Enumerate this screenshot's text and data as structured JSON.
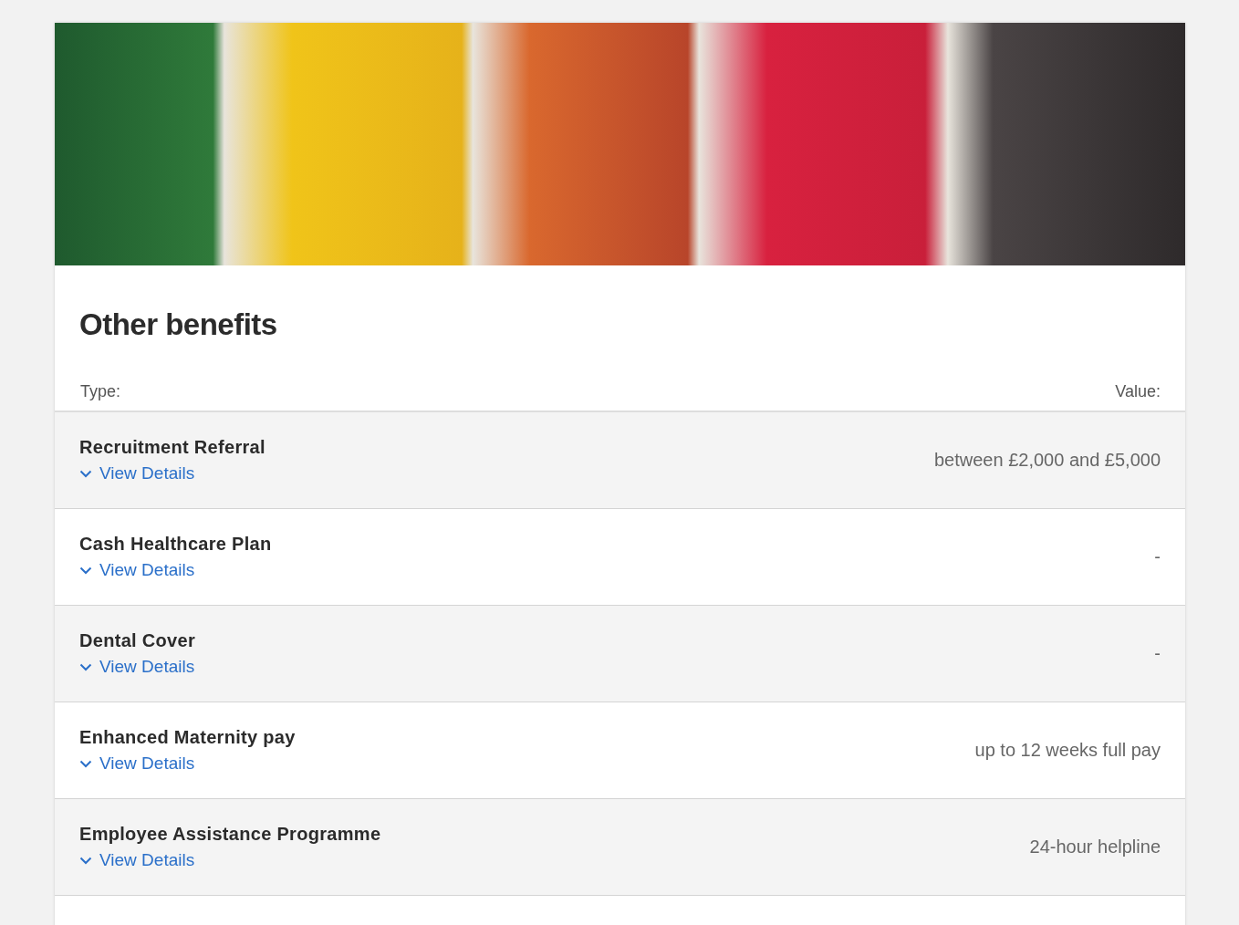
{
  "section": {
    "title": "Other benefits",
    "type_heading": "Type:",
    "value_heading": "Value:"
  },
  "benefits": [
    {
      "name": "Recruitment Referral",
      "link": "View Details",
      "value": "between £2,000 and £5,000"
    },
    {
      "name": "Cash Healthcare Plan",
      "link": "View Details",
      "value": "-"
    },
    {
      "name": "Dental Cover",
      "link": "View Details",
      "value": "-"
    },
    {
      "name": "Enhanced Maternity pay",
      "link": "View Details",
      "value": "up to 12 weeks full pay"
    },
    {
      "name": "Employee Assistance Programme",
      "link": "View Details",
      "value": "24-hour helpline"
    }
  ]
}
